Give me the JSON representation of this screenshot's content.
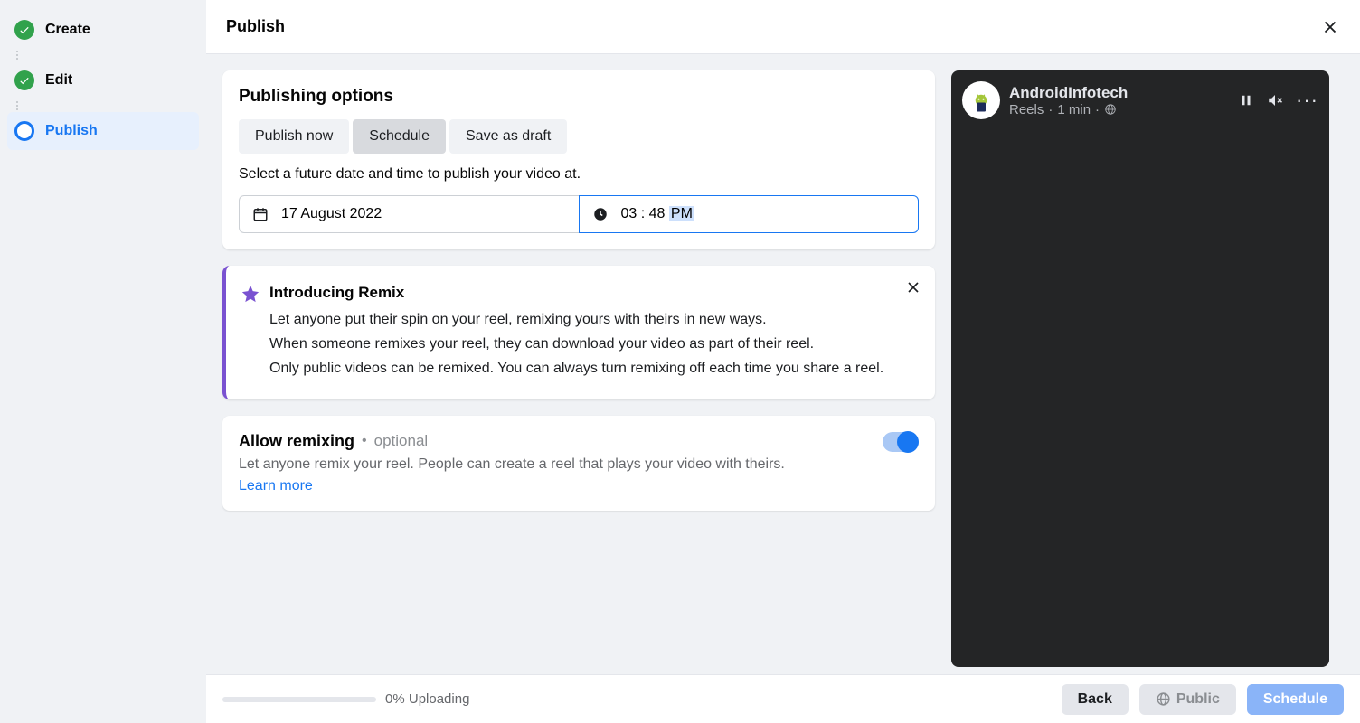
{
  "sidebar": {
    "steps": [
      {
        "label": "Create",
        "state": "done"
      },
      {
        "label": "Edit",
        "state": "done"
      },
      {
        "label": "Publish",
        "state": "current"
      }
    ]
  },
  "header": {
    "title": "Publish"
  },
  "publishing": {
    "title": "Publishing options",
    "options": {
      "now": "Publish now",
      "schedule": "Schedule",
      "draft": "Save as draft"
    },
    "helper": "Select a future date and time to publish your video at.",
    "date": "17 August 2022",
    "time_h": "03",
    "time_m": "48",
    "time_ampm": "PM"
  },
  "remix_intro": {
    "title": "Introducing Remix",
    "line1": "Let anyone put their spin on your reel, remixing yours with theirs in new ways.",
    "line2": "When someone remixes your reel, they can download your video as part of their reel.",
    "line3": "Only public videos can be remixed. You can always turn remixing off each time you share a reel."
  },
  "allow_remix": {
    "title": "Allow remixing",
    "optional": "optional",
    "desc": "Let anyone remix your reel. People can create a reel that plays your video with theirs.",
    "learn": "Learn more"
  },
  "preview": {
    "name": "AndroidInfotech",
    "type": "Reels",
    "duration": "1 min"
  },
  "footer": {
    "upload_pct": "0%",
    "upload_label": "Uploading",
    "back": "Back",
    "public": "Public",
    "schedule": "Schedule"
  }
}
